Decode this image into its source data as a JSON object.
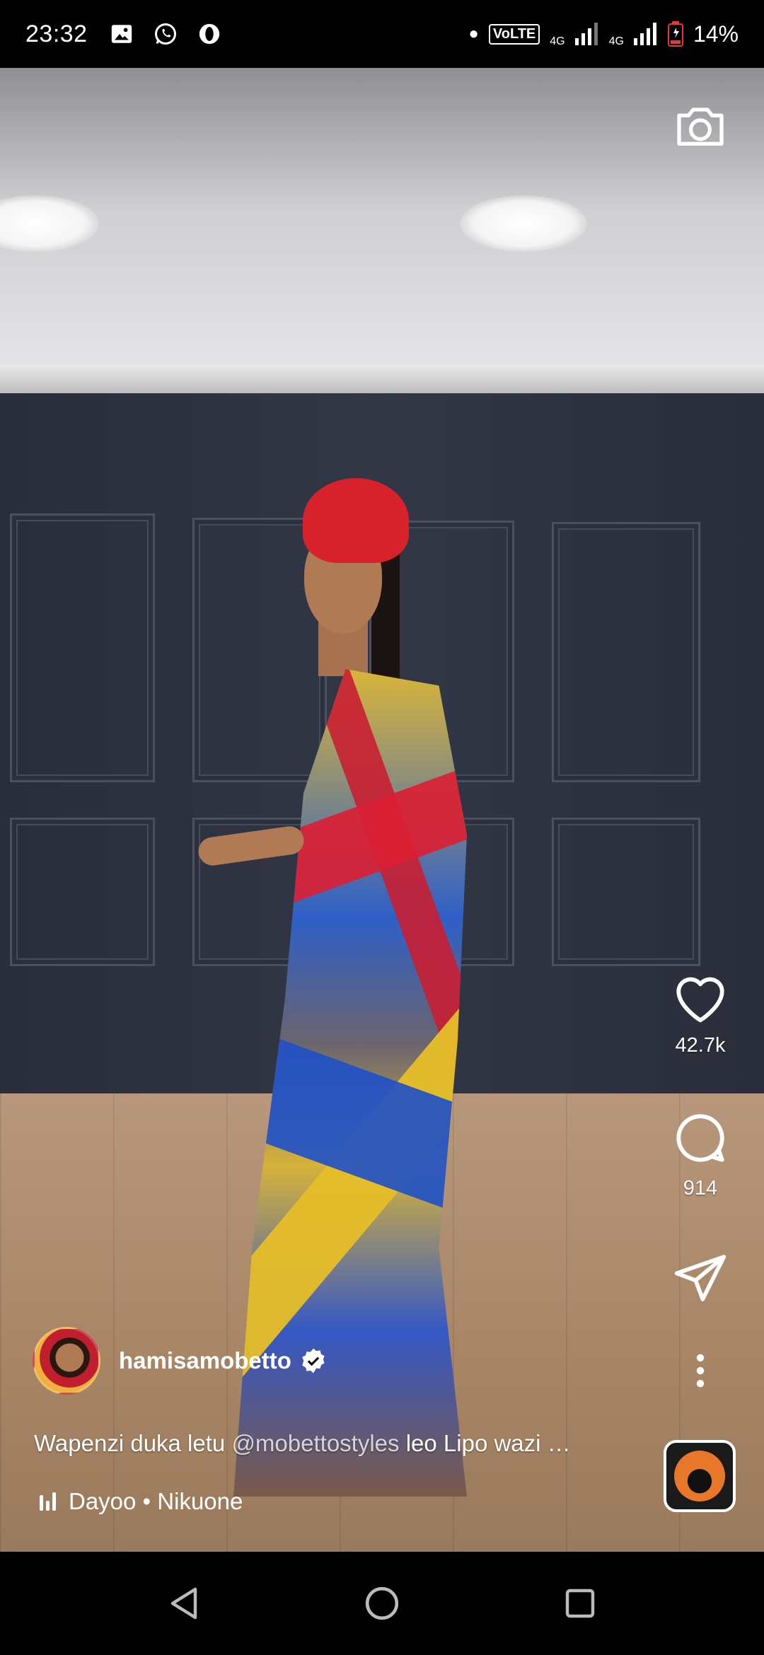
{
  "status_bar": {
    "time": "23:32",
    "left_icons": [
      "image-icon",
      "whatsapp-icon",
      "opera-icon"
    ],
    "volte": "VoLTE",
    "network_1": "4G",
    "network_2": "4G",
    "battery": "14%",
    "battery_color": "#e53935"
  },
  "post": {
    "username": "hamisamobetto",
    "verified": true,
    "caption_prefix": "Wapenzi duka letu ",
    "caption_mention": "@mobettostyles",
    "caption_suffix": " leo Lipo wazi …",
    "music": "Dayoo • Nikuone"
  },
  "actions": {
    "likes": "42.7k",
    "comments": "914"
  },
  "icons": {
    "camera": "camera-icon",
    "like": "heart-icon",
    "comment": "comment-icon",
    "share": "send-icon",
    "more": "more-icon",
    "music": "music-bars-icon",
    "back": "back-icon",
    "home": "home-icon",
    "recents": "recents-icon"
  }
}
